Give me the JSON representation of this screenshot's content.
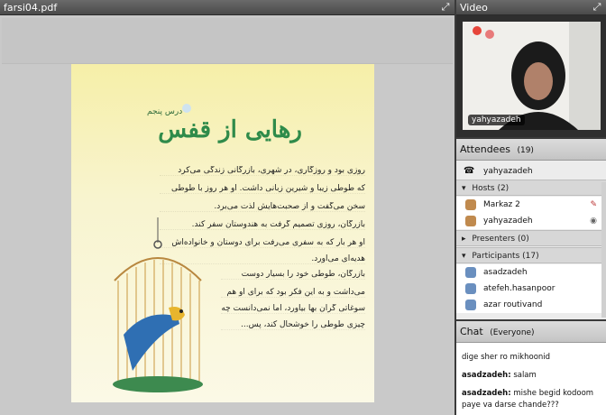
{
  "document": {
    "title": "farsi04.pdf",
    "page_title": "رهایی از قفس",
    "lesson_label": "درس پنجم",
    "lines": [
      "روزی بود و روزگاری، در شهری، بازرگانی زندگی می‌کرد",
      "که طوطی زیبا و شیرین زبانی داشت. او هر روز با طوطی",
      "سخن می‌گفت و از صحبت‌هایش لذت می‌برد.",
      "بازرگان، روزی تصمیم گرفت به هندوستان سفر کند.",
      "او هر بار که به سفری می‌رفت برای دوستان و خانواده‌اش",
      "هدیه‌ای می‌آورد.",
      "بازرگان، طوطی خود را بسیار دوست",
      "می‌داشت و به این فکر بود که برای او هم",
      "سوغاتی گران بها بیاورد، اما نمی‌دانست چه",
      "چیزی طوطی را خوشحال کند، پس..."
    ]
  },
  "video": {
    "title": "Video",
    "speaker_name": "yahyazadeh"
  },
  "attendees": {
    "title": "Attendees",
    "count": "(19)",
    "current_user": "yahyazadeh",
    "hosts_label": "Hosts (2)",
    "hosts": [
      "Markaz 2",
      "yahyazadeh"
    ],
    "presenters_label": "Presenters (0)",
    "participants_label": "Participants (17)",
    "participants": [
      "asadzadeh",
      "atefeh.hasanpoor",
      "azar routivand"
    ]
  },
  "chat": {
    "title": "Chat",
    "scope": "(Everyone)",
    "messages": [
      {
        "author": "",
        "text": "dige sher ro mikhoonid"
      },
      {
        "author": "asadzadeh:",
        "text": "salam"
      },
      {
        "author": "asadzadeh:",
        "text": "mishe begid kodoom paye va darse chande???"
      }
    ]
  },
  "colors": {
    "title_green": "#2f8b4a",
    "page_yellow": "#f6efa8",
    "header_gray": "#5a5a5a"
  }
}
